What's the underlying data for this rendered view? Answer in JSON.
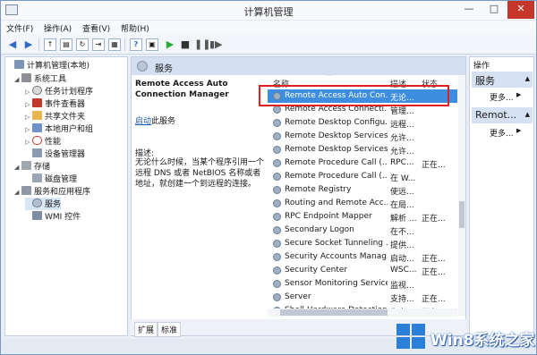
{
  "window": {
    "title": "计算机管理"
  },
  "menubar": {
    "items": [
      "文件(F)",
      "操作(A)",
      "查看(V)",
      "帮助(H)"
    ]
  },
  "toolbar": {
    "items": [
      "back-icon",
      "forward-icon",
      "up-icon",
      "show-hide-tree-icon",
      "refresh-icon",
      "export-icon",
      "help-icon",
      "properties-icon",
      "play-icon",
      "stop-icon",
      "pause-icon",
      "restart-icon"
    ]
  },
  "tree": {
    "items": [
      {
        "label": "计算机管理(本地)",
        "level": 0
      },
      {
        "label": "系统工具",
        "level": 1
      },
      {
        "label": "任务计划程序",
        "level": 2
      },
      {
        "label": "事件查看器",
        "level": 2
      },
      {
        "label": "共享文件夹",
        "level": 2
      },
      {
        "label": "本地用户和组",
        "level": 2
      },
      {
        "label": "性能",
        "level": 2
      },
      {
        "label": "设备管理器",
        "level": 2
      },
      {
        "label": "存储",
        "level": 1
      },
      {
        "label": "磁盘管理",
        "level": 2
      },
      {
        "label": "服务和应用程序",
        "level": 1
      },
      {
        "label": "服务",
        "level": 2
      },
      {
        "label": "WMI 控件",
        "level": 2
      }
    ]
  },
  "center": {
    "header": "服务",
    "selected_service": "Remote Access Auto Connection Manager",
    "start_link": "启动",
    "start_suffix": "此服务",
    "desc_label": "描述:",
    "desc_text": "无论什么时候，当某个程序引用一个远程 DNS 或者 NetBIOS 名称或者地址，就创建一个到远程的连接。",
    "columns": {
      "name": "名称",
      "desc": "描述",
      "status": "状态"
    },
    "services": [
      {
        "name": "Remote Access Auto Con...",
        "desc": "无论...",
        "status": ""
      },
      {
        "name": "Remote Access Connecti...",
        "desc": "管理...",
        "status": ""
      },
      {
        "name": "Remote Desktop Configu...",
        "desc": "远程...",
        "status": ""
      },
      {
        "name": "Remote Desktop Services",
        "desc": "允许...",
        "status": ""
      },
      {
        "name": "Remote Desktop Services ...",
        "desc": "允许...",
        "status": ""
      },
      {
        "name": "Remote Procedure Call (...",
        "desc": "RPC...",
        "status": "正在..."
      },
      {
        "name": "Remote Procedure Call (...",
        "desc": "在 W...",
        "status": ""
      },
      {
        "name": "Remote Registry",
        "desc": "使远...",
        "status": ""
      },
      {
        "name": "Routing and Remote Acc...",
        "desc": "在局...",
        "status": ""
      },
      {
        "name": "RPC Endpoint Mapper",
        "desc": "解析 ...",
        "status": "正在..."
      },
      {
        "name": "Secondary Logon",
        "desc": "在不...",
        "status": ""
      },
      {
        "name": "Secure Socket Tunneling ...",
        "desc": "提供...",
        "status": ""
      },
      {
        "name": "Security Accounts Manag...",
        "desc": "启动...",
        "status": "正在..."
      },
      {
        "name": "Security Center",
        "desc": "WSC...",
        "status": "正在..."
      },
      {
        "name": "Sensor Monitoring Service",
        "desc": "监视...",
        "status": ""
      },
      {
        "name": "Server",
        "desc": "支持...",
        "status": "正在..."
      },
      {
        "name": "Shell Hardware Detection",
        "desc": "为自...",
        "status": "正在..."
      }
    ]
  },
  "bottom_tabs": [
    "扩展",
    "标准"
  ],
  "actions": {
    "header": "操作",
    "sections": [
      {
        "title": "服务",
        "item": "更多..."
      },
      {
        "title": "Remot...",
        "item": "更多..."
      }
    ]
  },
  "watermark": {
    "text": "Win8系统之家"
  },
  "colors": {
    "selected_row": "#3d8ee0",
    "highlight_box": "#e02020",
    "accent": "#2b7fd8"
  }
}
